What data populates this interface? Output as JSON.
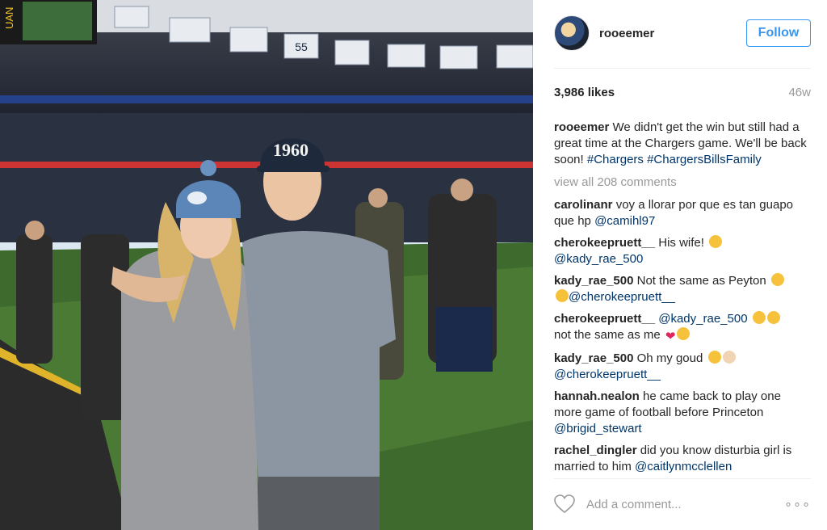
{
  "post": {
    "username": "rooeemer",
    "follow_label": "Follow",
    "likes": "3,986 likes",
    "age": "46w",
    "caption_user": "rooeemer",
    "caption_text": "We didn't get the win but still had a great time at the Chargers game. We'll be back soon!",
    "caption_tags": "#Chargers #ChargersBillsFamily",
    "view_all": "view all 208 comments",
    "add_comment_placeholder": "Add a comment..."
  },
  "comments": [
    {
      "user": "carolinanr",
      "text": "voy a llorar por que es tan guapo que hp",
      "mention": "@camihl97"
    },
    {
      "user": "cherokeepruett__",
      "text": "His wife!",
      "mention": "@kady_rae_500"
    },
    {
      "user": "kady_rae_500",
      "text": "Not the same as Peyton",
      "mention": "@cherokeepruett__"
    },
    {
      "user": "cherokeepruett__",
      "mention": "@kady_rae_500",
      "text": "not the same as me"
    },
    {
      "user": "kady_rae_500",
      "text": "Oh my goud",
      "mention": "@cherokeepruett__"
    },
    {
      "user": "hannah.nealon",
      "text": "he came back to play one more game of football before Princeton",
      "mention": "@brigid_stewart"
    },
    {
      "user": "rachel_dingler",
      "text": "did you know disturbia girl is married to him",
      "mention": "@caitlynmcclellen"
    }
  ],
  "photo": {
    "cap_text": "1960",
    "banner_number": "55",
    "scoreboard_text": "UAN"
  },
  "icons": {
    "like": "heart-outline-icon",
    "more": "ellipsis-icon"
  },
  "colors": {
    "follow": "#3897f0",
    "muted": "#999999",
    "mention": "#003569"
  }
}
